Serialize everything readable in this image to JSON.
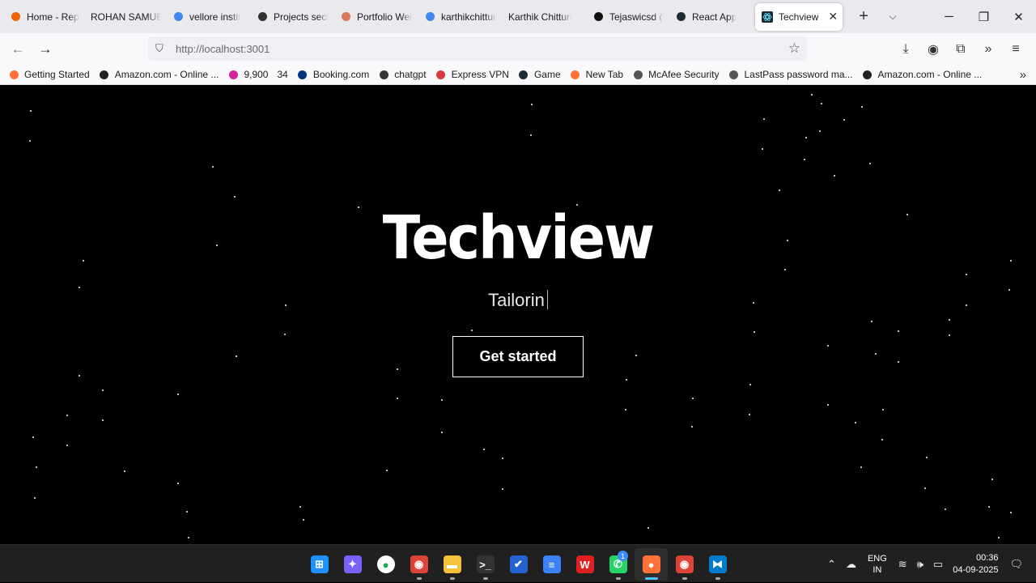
{
  "tabs": [
    {
      "label": "Home - Repl",
      "icon": "replit-icon",
      "color": "#f26207"
    },
    {
      "label": "ROHAN SAMUEL",
      "icon": "",
      "color": ""
    },
    {
      "label": "vellore instit",
      "icon": "google-icon",
      "color": "#4285f4"
    },
    {
      "label": "Projects secti",
      "icon": "chatgpt-icon",
      "color": "#333333"
    },
    {
      "label": "Portfolio Wel",
      "icon": "claude-icon",
      "color": "#d97757"
    },
    {
      "label": "karthikchittur",
      "icon": "google-icon",
      "color": "#4285f4"
    },
    {
      "label": "Karthik Chitturi",
      "icon": "",
      "color": ""
    },
    {
      "label": "Tejaswicsd (T",
      "icon": "github-icon",
      "color": "#111111"
    },
    {
      "label": "React App",
      "icon": "react-icon",
      "color": "#1e2a33"
    }
  ],
  "active_tab": {
    "label": "Techview",
    "icon": "react-icon"
  },
  "url": {
    "host": "http://localhost",
    "port": ":3001"
  },
  "bookmarks": [
    {
      "label": "Getting Started",
      "icon": "firefox-icon",
      "color": "#ff7139"
    },
    {
      "label": "Amazon.com - Online ...",
      "icon": "amazon-icon",
      "color": "#222222"
    },
    {
      "label": "9,900",
      "icon": "instagram-icon",
      "color": "#d6249f"
    },
    {
      "label": "34",
      "icon": "",
      "color": ""
    },
    {
      "label": "Booking.com",
      "icon": "booking-icon",
      "color": "#003580"
    },
    {
      "label": "chatgpt",
      "icon": "chatgpt-icon",
      "color": "#333333"
    },
    {
      "label": "Express VPN",
      "icon": "expressvpn-icon",
      "color": "#da3940"
    },
    {
      "label": "Game",
      "icon": "react-icon",
      "color": "#1e2a33"
    },
    {
      "label": "New Tab",
      "icon": "firefox-icon",
      "color": "#ff7139"
    },
    {
      "label": "McAfee Security",
      "icon": "globe-icon",
      "color": "#555555"
    },
    {
      "label": "LastPass password ma...",
      "icon": "globe-icon",
      "color": "#555555"
    },
    {
      "label": "Amazon.com - Online ...",
      "icon": "amazon-icon",
      "color": "#222222"
    }
  ],
  "page": {
    "title": "Techview",
    "typed_text": "Tailorin",
    "cta": "Get started",
    "background": "#000000"
  },
  "taskbar": {
    "apps": [
      {
        "name": "start-icon",
        "color": "#1e90ff",
        "glyph": "⊞"
      },
      {
        "name": "copilot-icon",
        "color": "#7b61ff",
        "glyph": "✦"
      },
      {
        "name": "mongodb-compass-icon",
        "color": "#ffffff",
        "glyph": "●"
      },
      {
        "name": "chrome-icon",
        "color": "#db4437",
        "glyph": "◉"
      },
      {
        "name": "file-explorer-icon",
        "color": "#f3c13a",
        "glyph": "▬"
      },
      {
        "name": "terminal-icon",
        "color": "#333333",
        "glyph": ">_"
      },
      {
        "name": "todo-icon",
        "color": "#2564cf",
        "glyph": "✔"
      },
      {
        "name": "notepad-icon",
        "color": "#3b82f6",
        "glyph": "≡"
      },
      {
        "name": "wps-office-icon",
        "color": "#e02020",
        "glyph": "W"
      },
      {
        "name": "whatsapp-icon",
        "color": "#25d366",
        "glyph": "✆",
        "badge": "1"
      },
      {
        "name": "firefox-icon",
        "color": "#ff7139",
        "glyph": "●"
      },
      {
        "name": "chrome-profile-icon",
        "color": "#db4437",
        "glyph": "◉"
      },
      {
        "name": "vscode-icon",
        "color": "#007acc",
        "glyph": "⧓"
      }
    ],
    "language": {
      "line1": "ENG",
      "line2": "IN"
    },
    "time": "00:36",
    "date": "04-09-2025"
  }
}
